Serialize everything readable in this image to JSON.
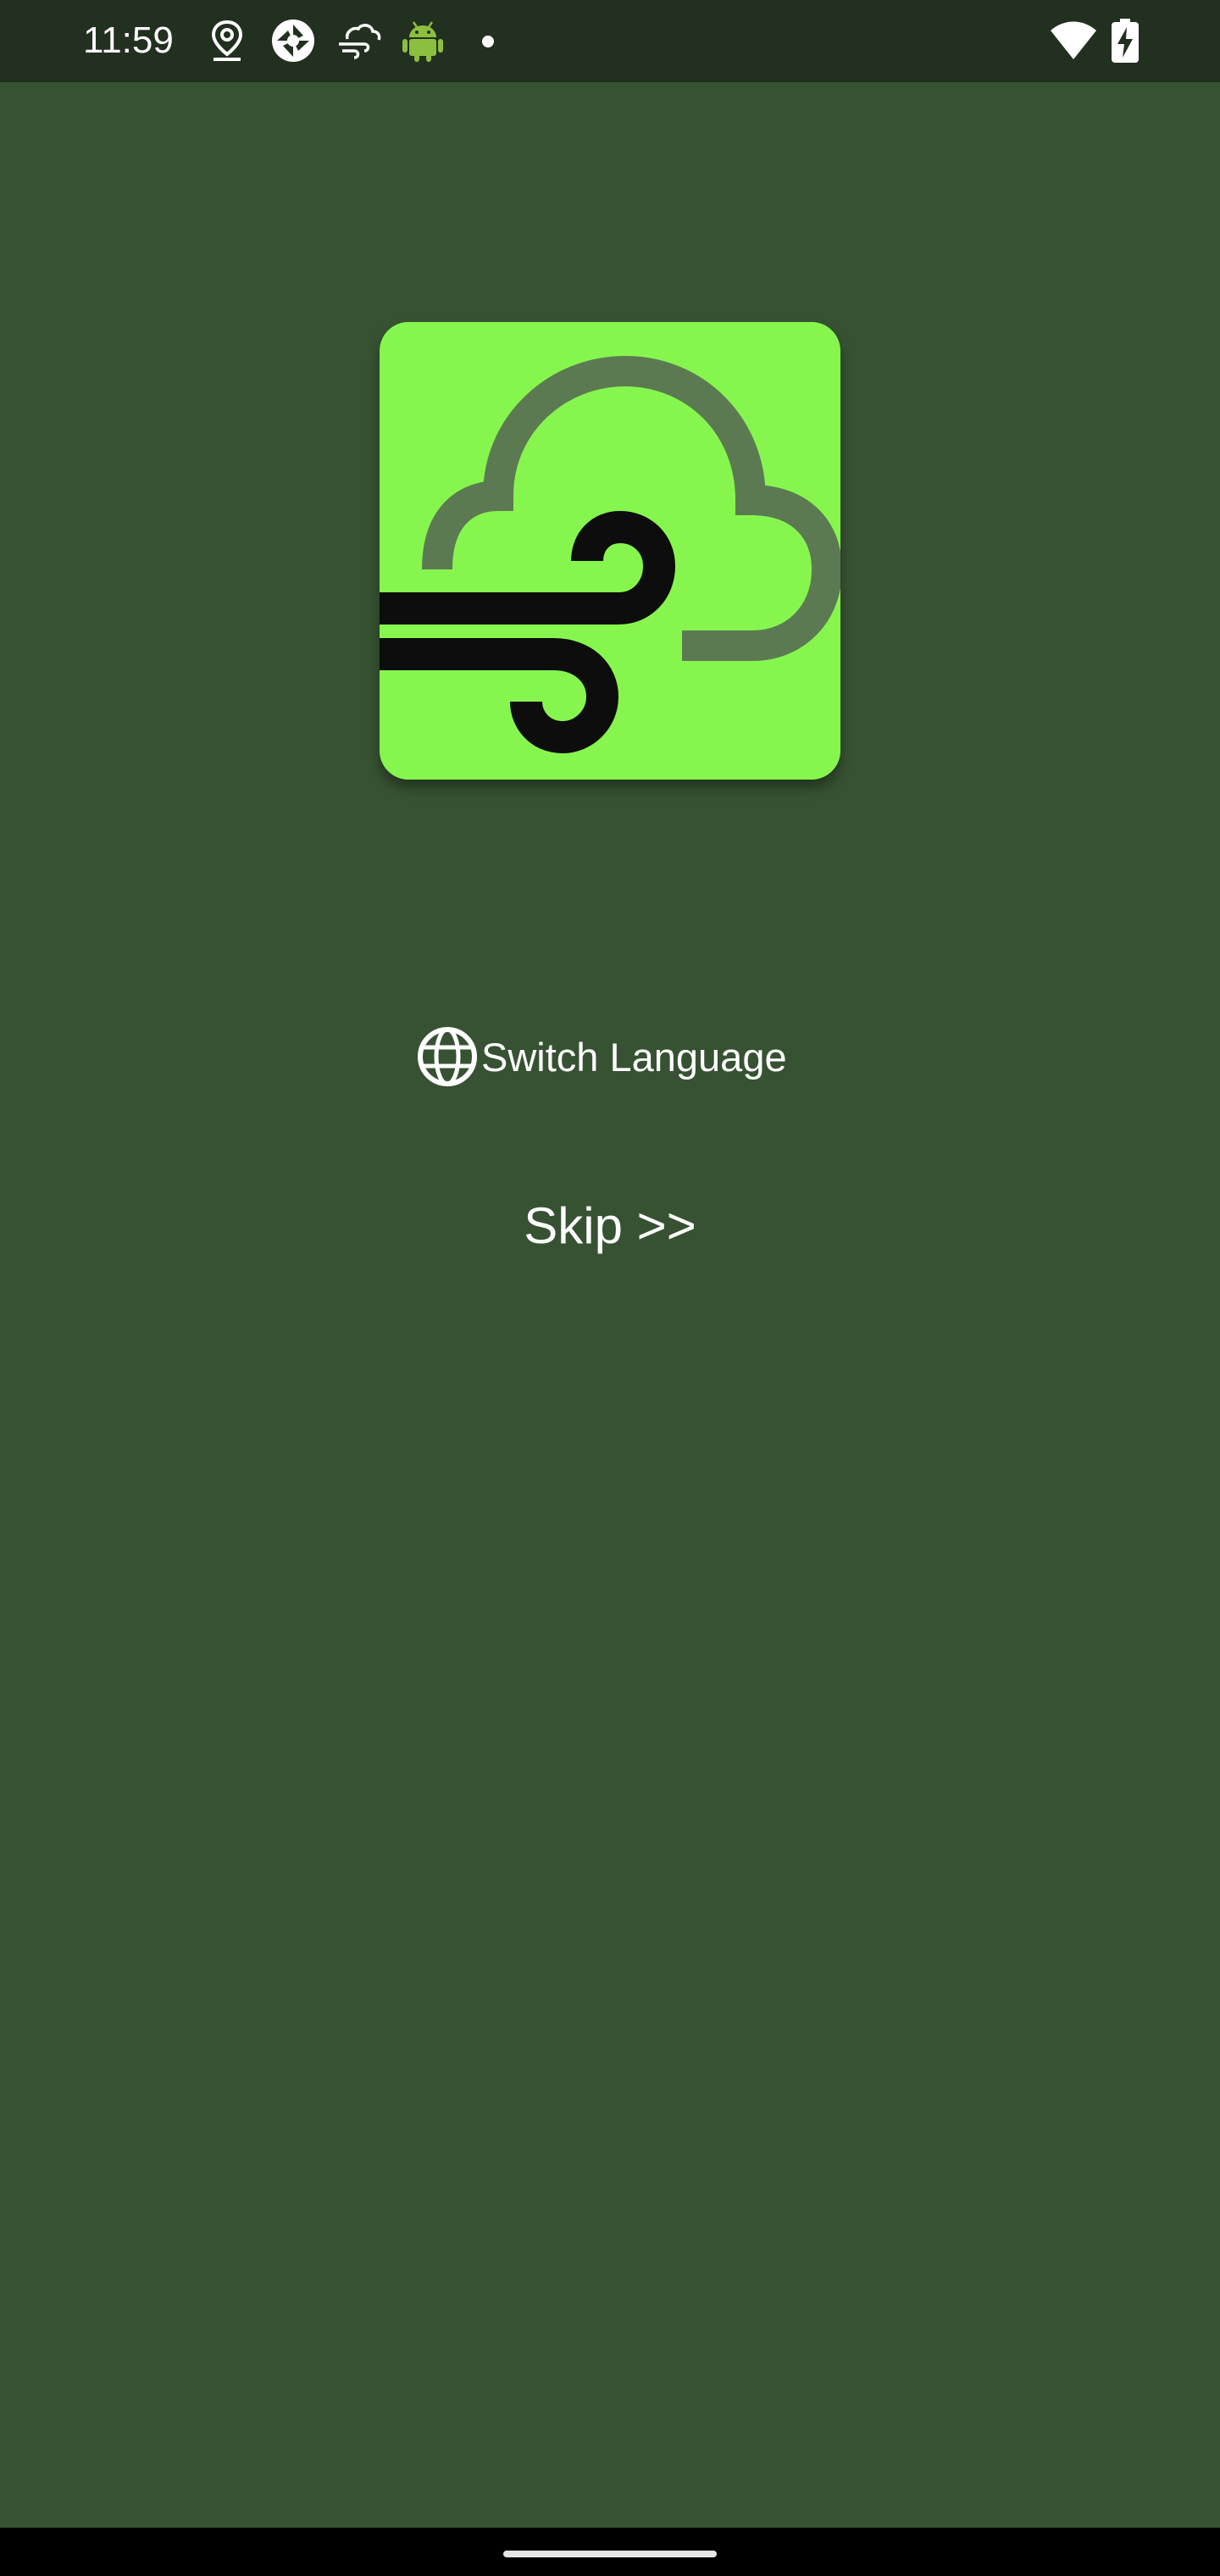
{
  "status_bar": {
    "time": "11:59",
    "icons_left": [
      "location-icon",
      "camera-shutter-icon",
      "weather-wind-icon",
      "android-icon",
      "notification-dot-icon"
    ],
    "icons_right": [
      "wifi-icon",
      "battery-charging-icon"
    ]
  },
  "app": {
    "logo_icon": "wind-cloud-logo",
    "logo_background": "#86f64f"
  },
  "actions": {
    "switch_language_label": "Switch Language",
    "switch_language_icon": "globe-icon",
    "skip_label": "Skip >>"
  },
  "colors": {
    "background": "#375232",
    "status_bar": "#22301f",
    "text": "#ffffff"
  }
}
